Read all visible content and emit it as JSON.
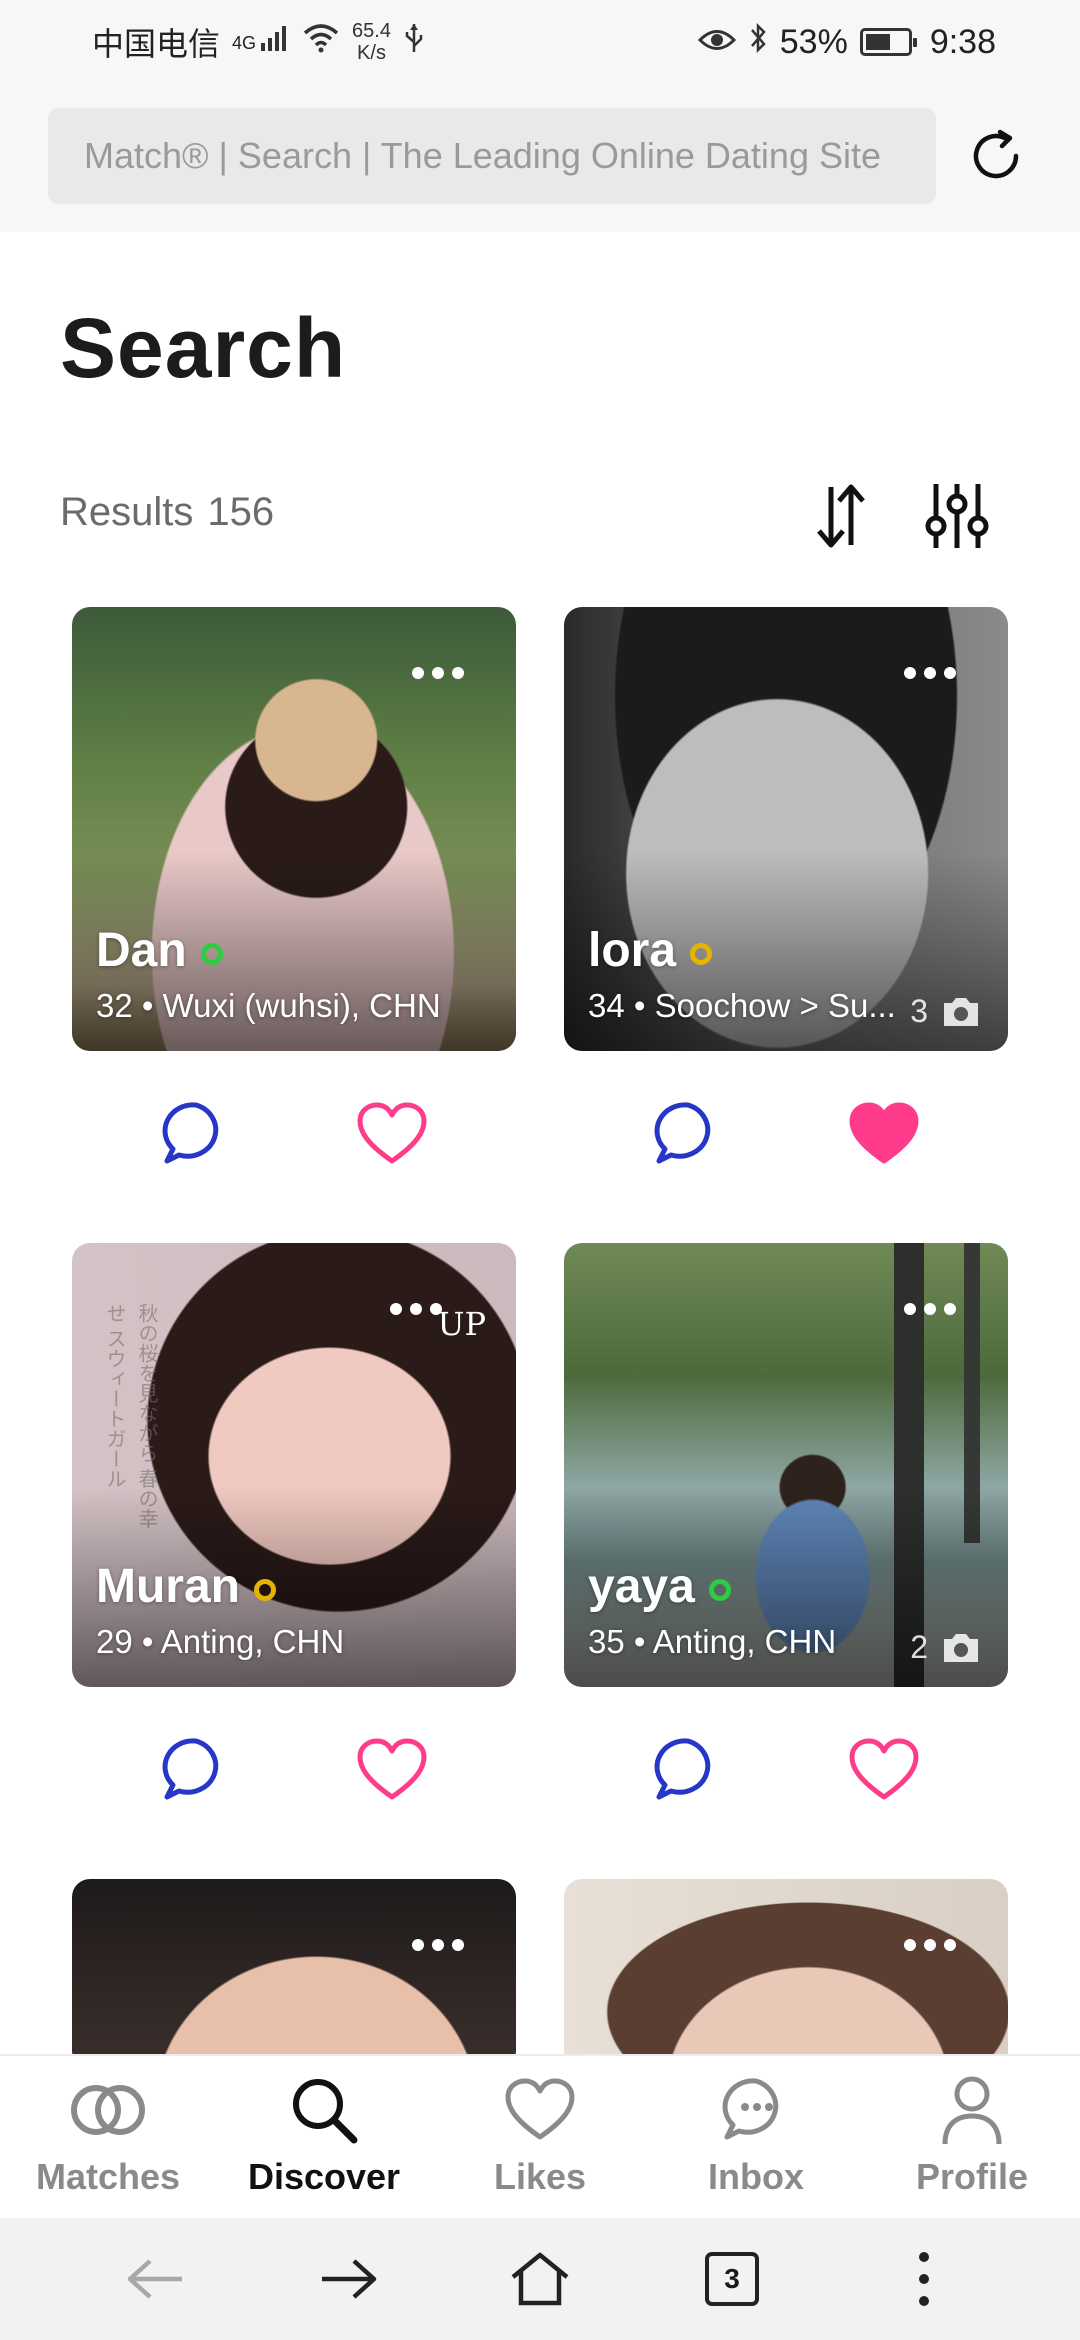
{
  "status_bar": {
    "carrier": "中国电信",
    "network": "4G",
    "speed_value": "65.4",
    "speed_unit": "K/s",
    "battery": "53%",
    "time": "9:38"
  },
  "browser": {
    "url_text": "Match® | Search | The Leading Online Dating Site",
    "tab_count": "3"
  },
  "page": {
    "title": "Search",
    "results_label": "Results",
    "results_count": "156"
  },
  "profiles": [
    {
      "name": "Dan",
      "meta": "32 • Wuxi (wuhsi), CHN",
      "status": "online",
      "liked": false
    },
    {
      "name": "lora",
      "meta": "34 • Soochow > Su...",
      "status": "away",
      "photo_count": "3",
      "liked": true
    },
    {
      "name": "Muran",
      "meta": "29 • Anting, CHN",
      "status": "away",
      "badge": "UP",
      "side_text": "秋の桜を見ながら 春の幸せ スウィートガール",
      "liked": false
    },
    {
      "name": "yaya",
      "meta": "35 • Anting, CHN",
      "status": "online",
      "photo_count": "2",
      "liked": false
    }
  ],
  "colors": {
    "online": "#2ecc40",
    "away": "#e6b400",
    "chat_blue": "#2536c8",
    "heart_pink": "#ff3c8c"
  },
  "nav": {
    "matches": "Matches",
    "discover": "Discover",
    "likes": "Likes",
    "inbox": "Inbox",
    "profile": "Profile"
  }
}
